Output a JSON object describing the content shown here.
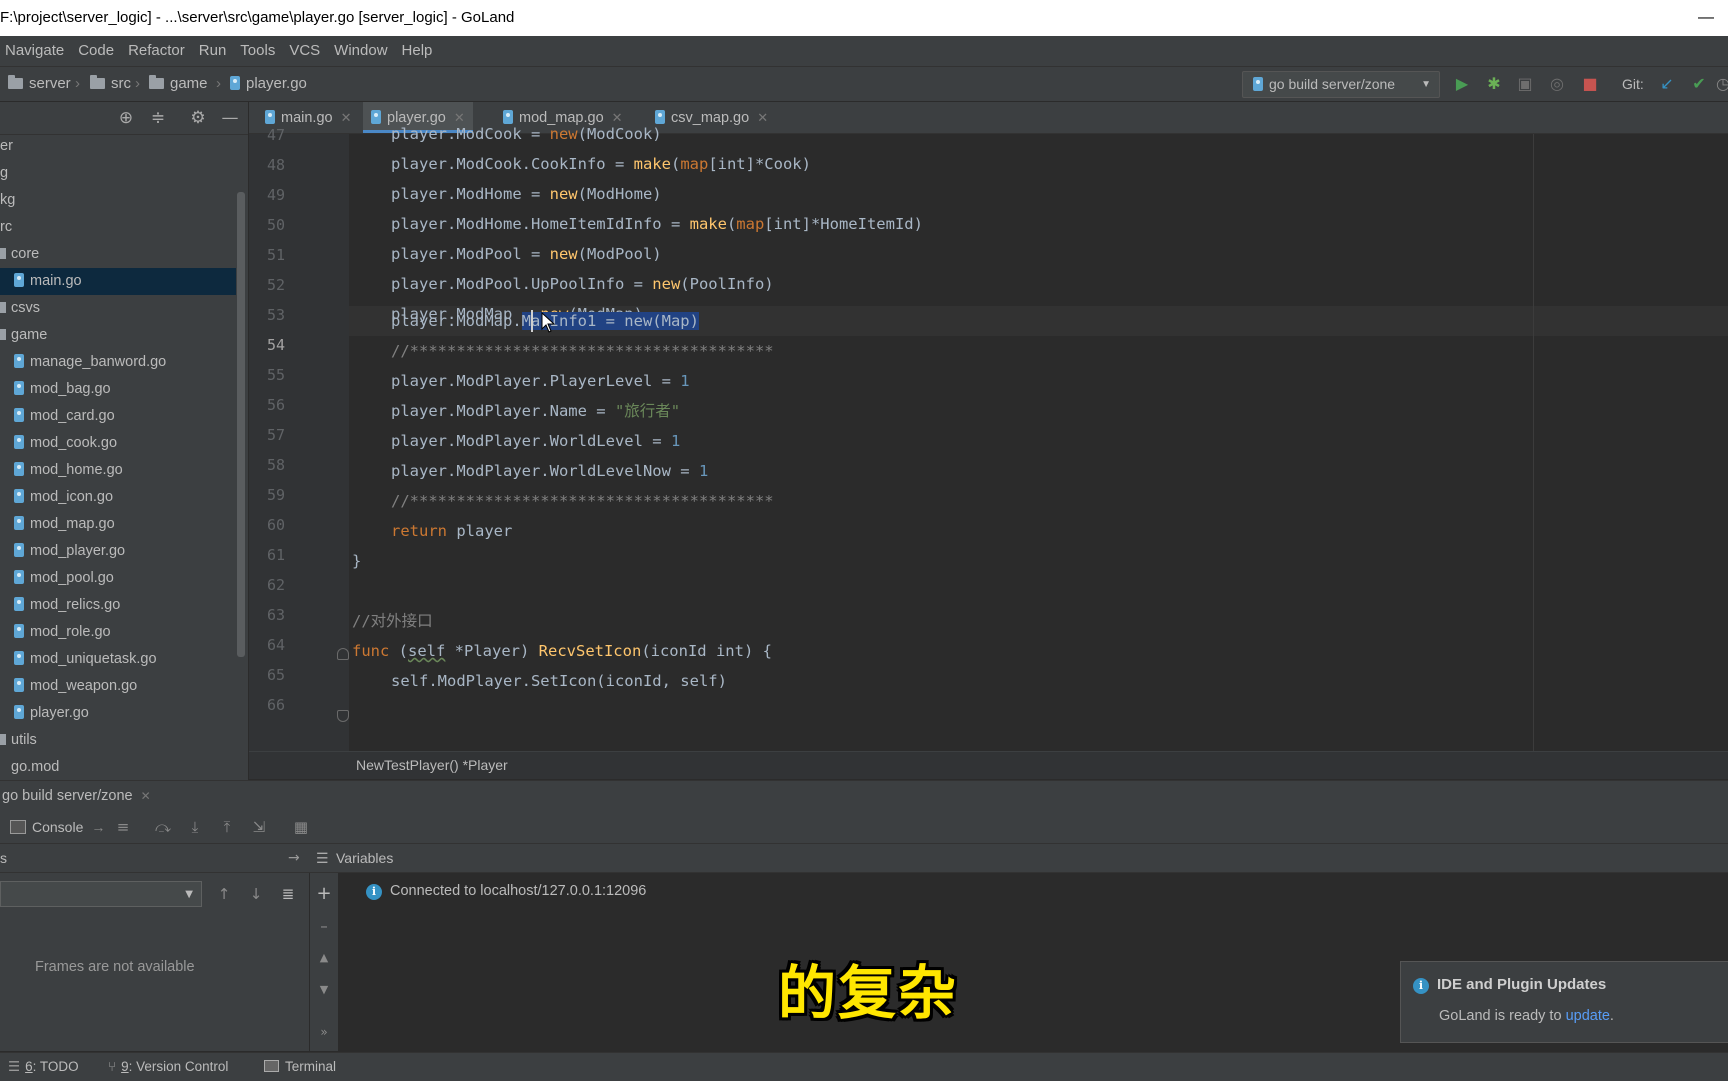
{
  "window": {
    "title": "F:\\project\\server_logic] - ...\\server\\src\\game\\player.go [server_logic] - GoLand",
    "minimize": "—"
  },
  "menu": [
    "Navigate",
    "Code",
    "Refactor",
    "Run",
    "Tools",
    "VCS",
    "Window",
    "Help"
  ],
  "breadcrumb": {
    "items": [
      "server",
      "src",
      "game",
      "player.go"
    ]
  },
  "run_config": {
    "label": "go build server/zone",
    "git_label": "Git:"
  },
  "project_tree": [
    {
      "label": "er",
      "type": "partial"
    },
    {
      "label": "g",
      "type": "partial"
    },
    {
      "label": "kg",
      "type": "partial"
    },
    {
      "label": "rc",
      "type": "partial"
    },
    {
      "label": "core",
      "type": "folder"
    },
    {
      "label": "main.go",
      "type": "file",
      "selected": true
    },
    {
      "label": "csvs",
      "type": "folder"
    },
    {
      "label": "game",
      "type": "folder"
    },
    {
      "label": "manage_banword.go",
      "type": "file"
    },
    {
      "label": "mod_bag.go",
      "type": "file"
    },
    {
      "label": "mod_card.go",
      "type": "file"
    },
    {
      "label": "mod_cook.go",
      "type": "file"
    },
    {
      "label": "mod_home.go",
      "type": "file"
    },
    {
      "label": "mod_icon.go",
      "type": "file"
    },
    {
      "label": "mod_map.go",
      "type": "file"
    },
    {
      "label": "mod_player.go",
      "type": "file"
    },
    {
      "label": "mod_pool.go",
      "type": "file"
    },
    {
      "label": "mod_relics.go",
      "type": "file"
    },
    {
      "label": "mod_role.go",
      "type": "file"
    },
    {
      "label": "mod_uniquetask.go",
      "type": "file"
    },
    {
      "label": "mod_weapon.go",
      "type": "file"
    },
    {
      "label": "player.go",
      "type": "file"
    },
    {
      "label": "utils",
      "type": "folder"
    },
    {
      "label": "go.mod",
      "type": "file"
    }
  ],
  "tabs": [
    {
      "label": "main.go",
      "active": false
    },
    {
      "label": "player.go",
      "active": true
    },
    {
      "label": "mod_map.go",
      "active": false
    },
    {
      "label": "csv_map.go",
      "active": false
    }
  ],
  "line_numbers": [
    "47",
    "48",
    "49",
    "50",
    "51",
    "52",
    "53",
    "54",
    "55",
    "56",
    "57",
    "58",
    "59",
    "60",
    "61",
    "62",
    "63",
    "64",
    "65",
    "66"
  ],
  "code": {
    "l47": {
      "a": "player.ModCook = ",
      "b": "new",
      "c": "(ModCook)"
    },
    "l48": {
      "a": "player.ModCook.CookInfo = ",
      "b": "make",
      "c": "(",
      "d": "map",
      "e": "[int]*Cook)"
    },
    "l49": {
      "a": "player.ModHome = ",
      "b": "new",
      "c": "(ModHome)"
    },
    "l50": {
      "a": "player.ModHome.HomeItemIdInfo = ",
      "b": "make",
      "c": "(",
      "d": "map",
      "e": "[int]*HomeItemId)"
    },
    "l51": {
      "a": "player.ModPool = ",
      "b": "new",
      "c": "(ModPool)"
    },
    "l52": {
      "a": "player.ModPool.UpPoolInfo = ",
      "b": "new",
      "c": "(PoolInfo)"
    },
    "l53": {
      "a": "player.ModMap = ",
      "b": "new",
      "c": "(ModMap)"
    },
    "l54": {
      "a": "player.ModMap.",
      "sel": "MapInfo1 = new(Map)"
    },
    "l55": {
      "a": "//***************************************"
    },
    "l56": {
      "a": "player.ModPlayer.PlayerLevel = ",
      "n": "1"
    },
    "l57": {
      "a": "player.ModPlayer.Name = ",
      "s": "\"旅行者\""
    },
    "l58": {
      "a": "player.ModPlayer.WorldLevel = ",
      "n": "1"
    },
    "l59": {
      "a": "player.ModPlayer.WorldLevelNow = ",
      "n": "1"
    },
    "l60": {
      "a": "//***************************************"
    },
    "l61": {
      "k": "return",
      "a": " player"
    },
    "l62": {
      "a": "}"
    },
    "l64": {
      "a": "//对外接口"
    },
    "l65": {
      "k": "func",
      "a": " (",
      "self": "self",
      "b": " *Player) ",
      "f": "RecvSetIcon",
      "c": "(iconId int) {"
    },
    "l66": {
      "a": "self.ModPlayer.SetIcon(iconId, self)"
    }
  },
  "editor_breadcrumb": "NewTestPlayer() *Player",
  "debug": {
    "session_tab": "go build server/zone",
    "console_label": "Console",
    "frames_label": "s",
    "variables_label": "Variables",
    "frames_empty": "Frames are not available",
    "connected_msg": "Connected to localhost/127.0.0.1:12096",
    "more": "»"
  },
  "status_bar": [
    {
      "num": "6",
      "label": ": TODO"
    },
    {
      "num": "9",
      "label": ": Version Control"
    },
    {
      "num": "",
      "label": "Terminal"
    }
  ],
  "notification": {
    "title": "IDE and Plugin Updates",
    "body": "GoLand is ready to ",
    "link": "update",
    "end": "."
  },
  "subtitle": "的复杂",
  "colors": {
    "accent": "#4a88c7",
    "keyword": "#cc7832",
    "function": "#ffc66d",
    "string": "#6a8759",
    "number": "#6897bb",
    "selection": "#214283",
    "subtitle": "#ffe600",
    "run_green": "#499c54",
    "stop_red": "#c75450"
  }
}
